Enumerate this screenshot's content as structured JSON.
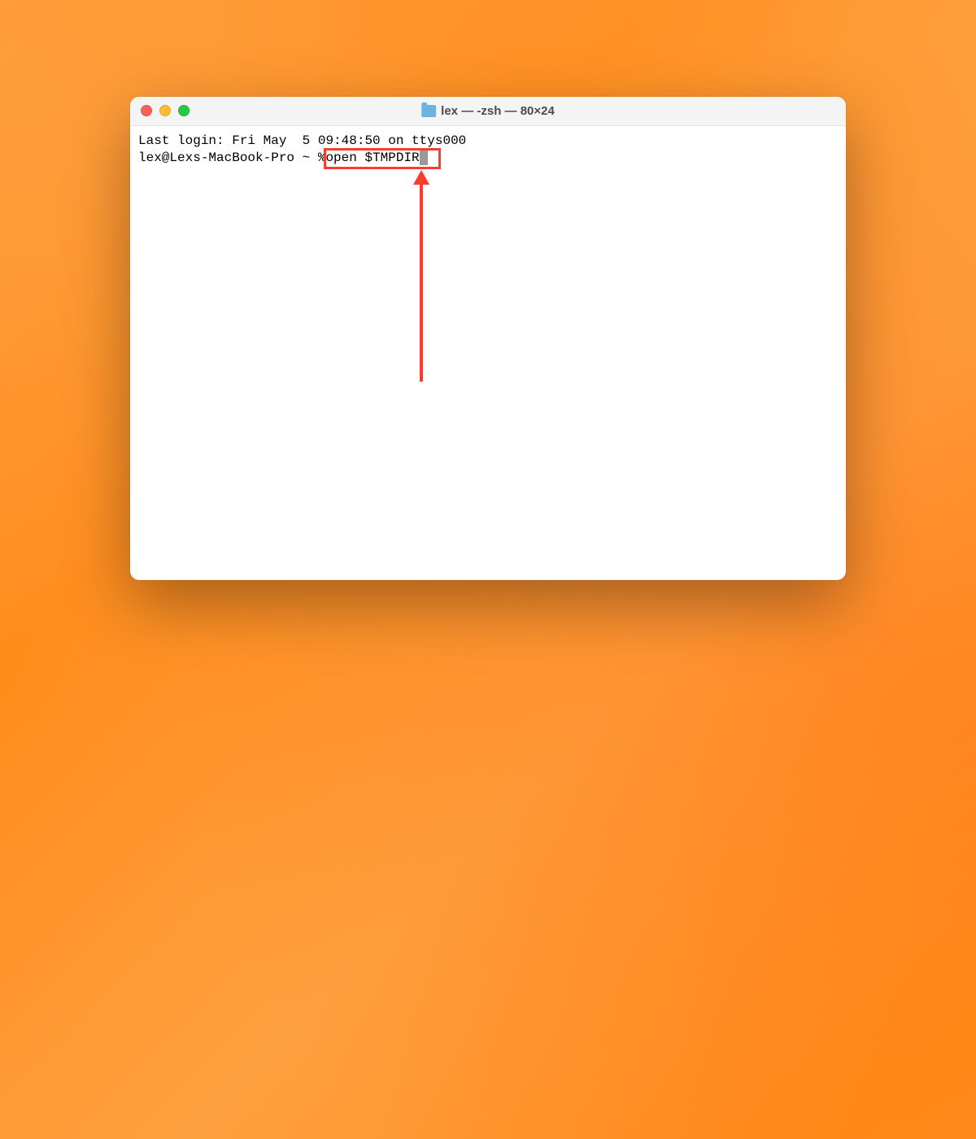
{
  "window": {
    "title": "lex — -zsh — 80×24"
  },
  "terminal": {
    "line1": "Last login: Fri May  5 09:48:50 on ttys000",
    "prompt": "lex@Lexs-MacBook-Pro ~ % ",
    "command": "open $TMPDIR"
  },
  "colors": {
    "highlight": "#ff3b30",
    "traffic_red": "#ff5f57",
    "traffic_yellow": "#febc2e",
    "traffic_green": "#28c840"
  }
}
